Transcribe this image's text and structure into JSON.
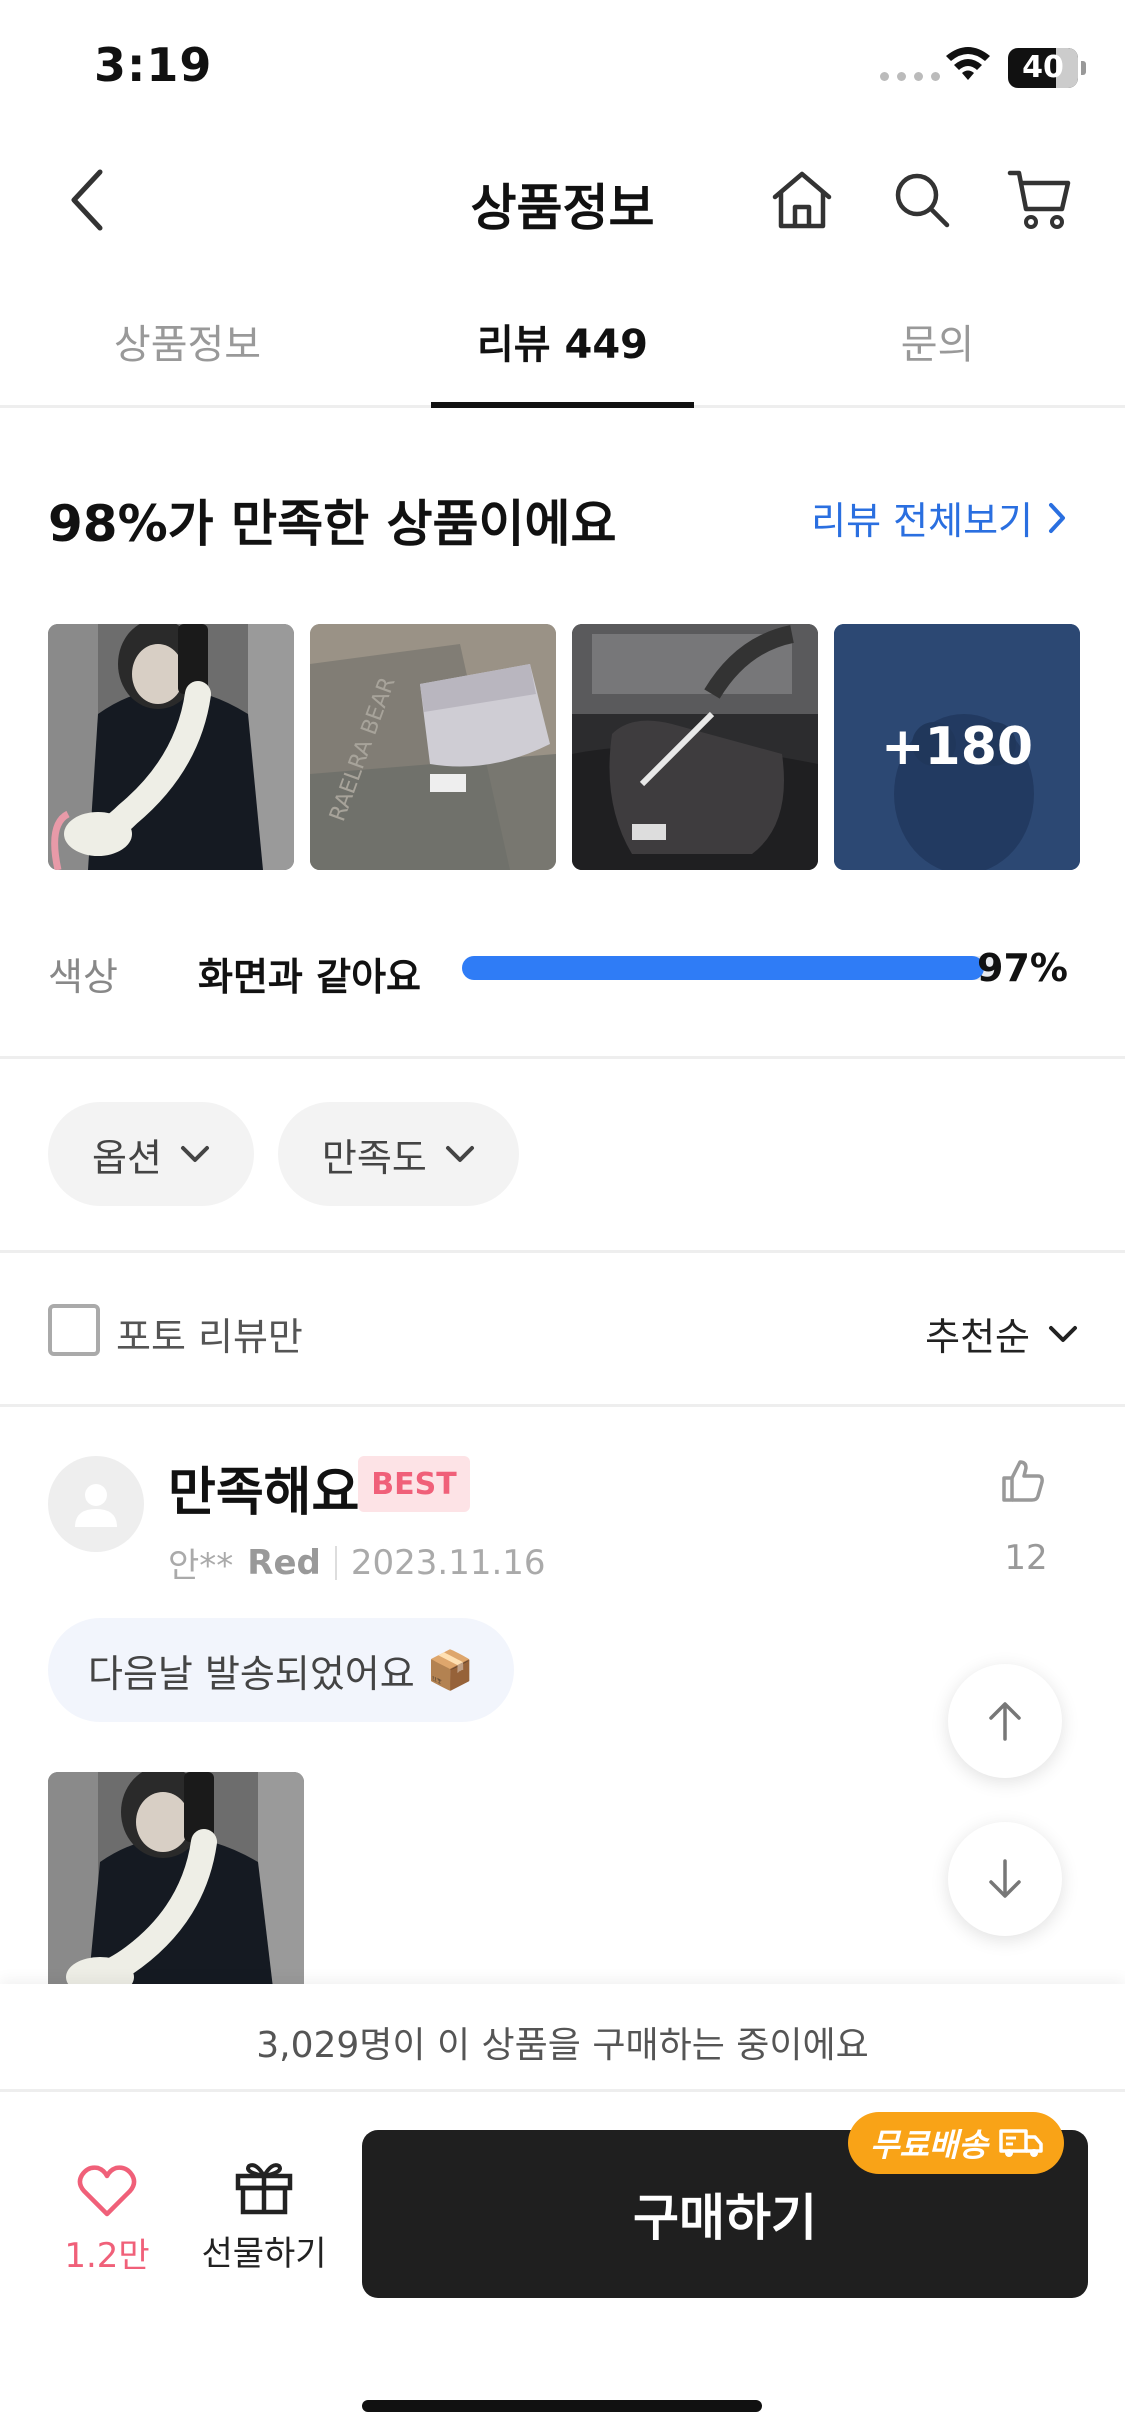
{
  "status_bar": {
    "time": "3:19",
    "battery": "40"
  },
  "nav": {
    "title": "상품정보"
  },
  "tabs": [
    {
      "label": "상품정보"
    },
    {
      "label": "리뷰 449"
    },
    {
      "label": "문의"
    }
  ],
  "summary": {
    "headline": "98%가 만족한 상품이에요",
    "see_all": "리뷰 전체보기",
    "more_photos": "+180",
    "rating": {
      "label": "색상",
      "value": "화면과 같아요",
      "percent_text": "97%",
      "percent": 97
    }
  },
  "filters": {
    "option": "옵션",
    "satisfaction": "만족도"
  },
  "sort": {
    "photo_only": "포토 리뷰만",
    "order": "추천순"
  },
  "review": {
    "title": "만족해요",
    "badge": "BEST",
    "author": "안**",
    "option": "Red",
    "date": "2023.11.16",
    "likes": "12",
    "tag": "다음날 발송되었어요",
    "tag_emoji": "📦"
  },
  "bottom": {
    "banner": "3,029명이 이 상품을 구매하는 중이에요",
    "wish_count": "1.2만",
    "gift_label": "선물하기",
    "buy_label": "구매하기",
    "free_shipping": "무료배송"
  },
  "colors": {
    "accent_blue": "#2f7cf6",
    "link_blue": "#2a6fe0",
    "pink": "#f06079",
    "orange": "#f9a317",
    "buy_bg": "#1f1f1f"
  }
}
